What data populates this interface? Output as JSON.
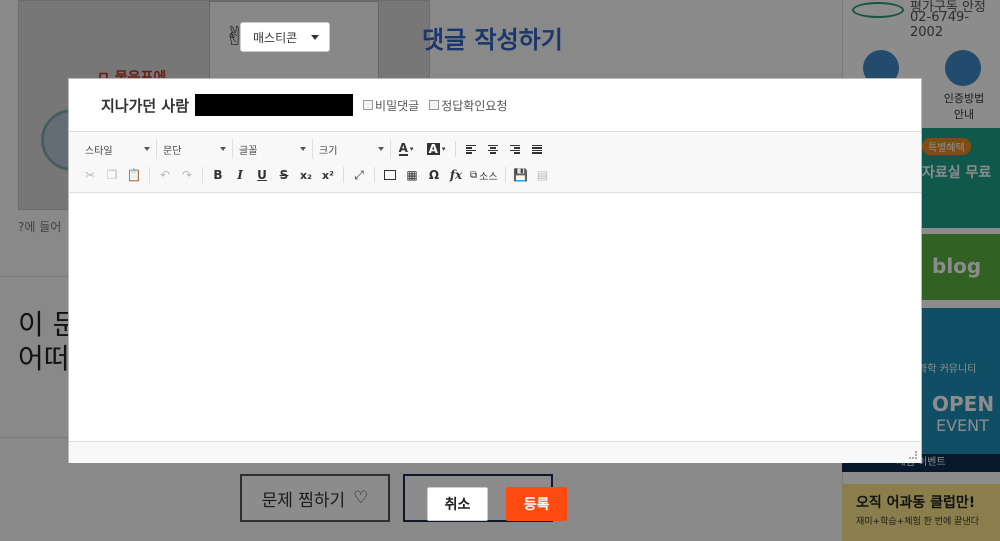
{
  "background": {
    "comment_title": "댓글 작성하기",
    "image_caption": "?에 들어",
    "image_red_text": "ㅁ 물음표에",
    "image_math": "✌ = ✌✌",
    "question_text_line1": "이 문",
    "question_text_line2": "어떠",
    "zzim_button": "문제 찜하기",
    "zzim_icon": "heart-outline-icon"
  },
  "sidebar": {
    "phone_prefix": "평가구독 안정",
    "phone": "02-6749-2002",
    "auth_label_line1": "인증방법",
    "auth_label_line2": "안내",
    "banner_special": "특별혜택",
    "banner_free": "자료실 무료",
    "banner_blog": "blog",
    "banner_community": "과학 커뮤니티",
    "banner_open": "OPEN",
    "banner_event": "EVENT",
    "banner_event_bottom": "체험 이벤트",
    "banner_club_line1": "오직 어과동 클럽만!",
    "banner_club_line2": "재미+학습+체험 한 번에 끝낸다"
  },
  "emoticon": {
    "label": "매스티콘"
  },
  "dialog": {
    "author": "지나가던 사람",
    "secret_comment": "비밀댓글",
    "answer_check": "정답확인요청"
  },
  "toolbar": {
    "style_combo": "스타일",
    "paragraph_combo": "문단",
    "font_combo": "글꼴",
    "size_combo": "크기",
    "text_color": "A",
    "bg_color": "A",
    "source_label": "소스",
    "bold": "B",
    "italic": "I",
    "underline": "U",
    "strike": "S",
    "subscript": "x₂",
    "superscript": "x²",
    "omega": "Ω",
    "formula": "fx"
  },
  "actions": {
    "cancel": "취소",
    "submit": "등록"
  },
  "colors": {
    "accent": "#ff4a12",
    "title_blue": "#2f63c8",
    "overlay": "rgba(0,0,0,0.45)"
  }
}
